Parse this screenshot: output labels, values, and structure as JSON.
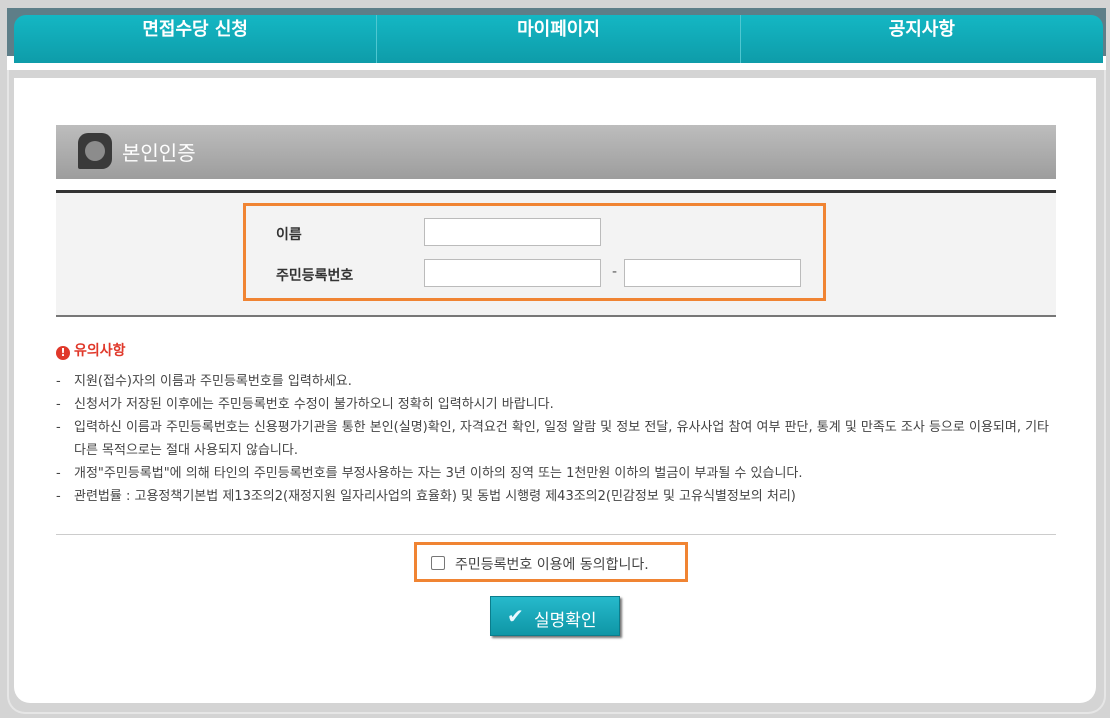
{
  "nav": {
    "items": [
      {
        "label": "면접수당 신청"
      },
      {
        "label": "마이페이지"
      },
      {
        "label": "공지사항"
      }
    ]
  },
  "section": {
    "title": "본인인증"
  },
  "form": {
    "name_label": "이름",
    "rrn_label": "주민등록번호",
    "rrn_separator": "-",
    "name_value": "",
    "rrn_front_value": "",
    "rrn_back_value": ""
  },
  "notice": {
    "title": "유의사항",
    "items": [
      "지원(접수)자의 이름과 주민등록번호를 입력하세요.",
      "신청서가 저장된 이후에는 주민등록번호 수정이 불가하오니 정확히 입력하시기 바랍니다.",
      "입력하신 이름과 주민등록번호는 신용평가기관을 통한 본인(실명)확인, 자격요건 확인, 일정 알람 및 정보 전달, 유사사업 참여 여부 판단, 통계 및 만족도 조사 등으로 이용되며, 기타 다른 목적으로는 절대 사용되지 않습니다.",
      "개정\"주민등록법\"에 의해 타인의 주민등록번호를 부정사용하는 자는 3년 이하의 징역 또는 1천만원 이하의 벌금이 부과될 수 있습니다.",
      "관련법률 : 고용정책기본법 제13조의2(재정지원 일자리사업의 효율화) 및 동법 시행령 제43조의2(민감정보 및 고유식별정보의 처리)"
    ]
  },
  "agreement": {
    "label": "주민등록번호 이용에 동의합니다.",
    "checked": false
  },
  "confirm_button": {
    "label": "실명확인"
  },
  "colors": {
    "nav": "#11a9b6",
    "accent_frame": "#f08433",
    "warning": "#e0382a",
    "button": "#1aa7b8"
  }
}
